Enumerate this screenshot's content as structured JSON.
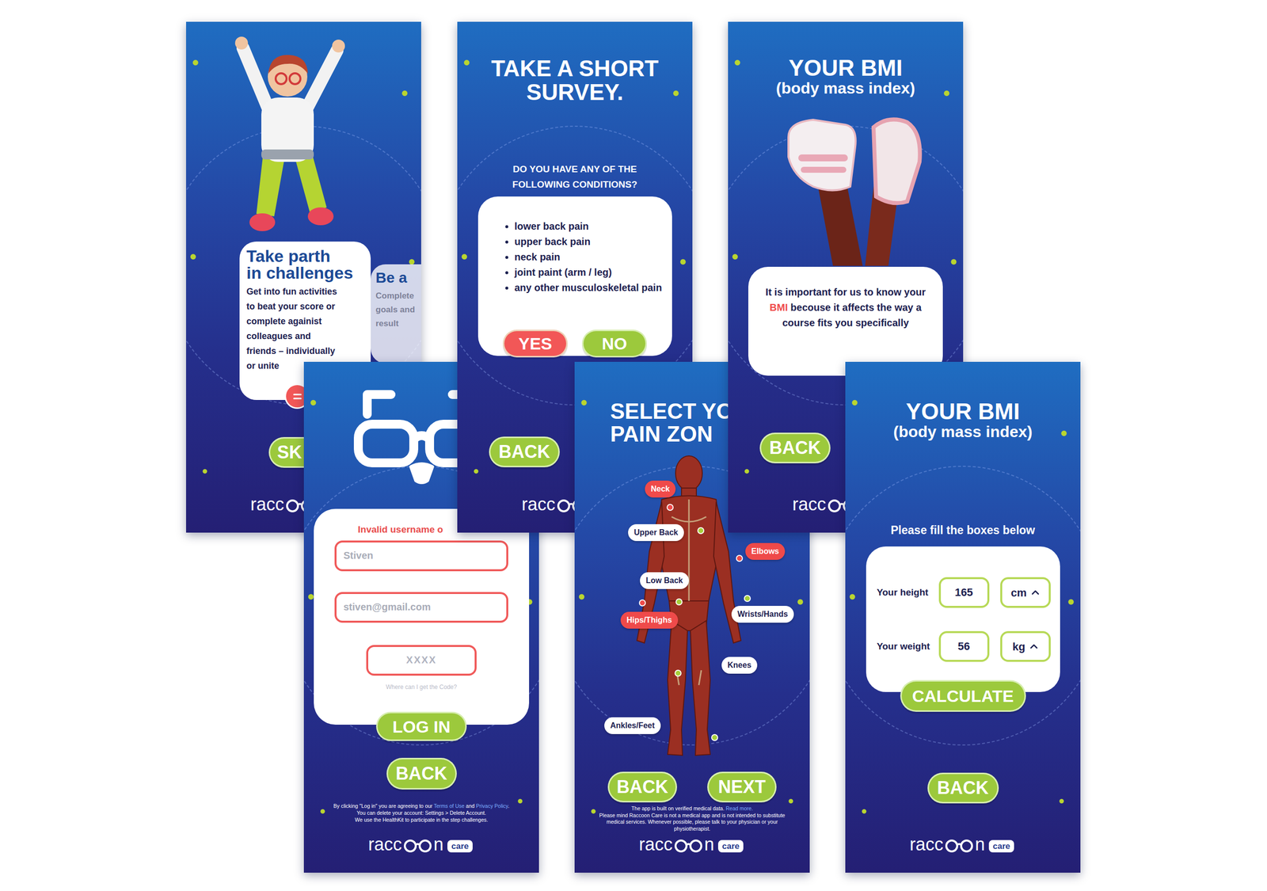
{
  "screens": {
    "challenges": {
      "card": {
        "title": [
          "Take parth",
          "in challenges"
        ],
        "body": [
          "Get into fun activities",
          "to beat your score or",
          "complete againist",
          "colleagues and",
          "friends – individually",
          "or unite"
        ]
      },
      "next_card": {
        "title": "Be a",
        "body": [
          "Complete",
          "goals and",
          "result"
        ]
      },
      "skip_button": "SK",
      "logo": {
        "text": "racc"
      }
    },
    "survey": {
      "title": [
        "TAKE A SHORT",
        "SURVEY."
      ],
      "question": [
        "DO YOU HAVE ANY OF THE",
        "FOLLOWING CONDITIONS?"
      ],
      "conditions": [
        "lower back pain",
        "upper back pain",
        "neck pain",
        "joint paint (arm / leg)",
        "any other musculoskeletal pain"
      ],
      "yes_button": "YES",
      "no_button": "NO",
      "back_button": "BACK",
      "logo": {
        "text": "racc"
      }
    },
    "bmi_intro": {
      "title": "YOUR BMI",
      "subtitle": "(body mass index)",
      "message": {
        "before": "It is important for us to know your ",
        "highlight": "BMI",
        "after": " becouse it affects the way a course fits you specifically"
      },
      "back_button": "BACK",
      "logo": {
        "text": "racc"
      }
    },
    "login": {
      "error": "Invalid username o",
      "fields": [
        {
          "value": "Stiven"
        },
        {
          "value": "stiven@gmail.com"
        }
      ],
      "code": {
        "placeholder": "XXXX"
      },
      "code_help": "Where can I get the Code?",
      "login_button": "LOG IN",
      "back_button": "BACK",
      "legal": [
        [
          {
            "kind": "text",
            "text": "By clicking \"Log in\" you are agreeing to our "
          },
          {
            "kind": "link",
            "text": "Terms of Use"
          },
          {
            "kind": "text",
            "text": " and "
          },
          {
            "kind": "link",
            "text": "Privacy Policy"
          },
          {
            "kind": "text",
            "text": "."
          }
        ],
        [
          {
            "kind": "text",
            "text": "You can delete  your account: Settings > Delete Account."
          }
        ],
        [
          {
            "kind": "text",
            "text": "We use the HealthKit to participate in the step challenges."
          }
        ]
      ],
      "logo": {
        "text": "racc",
        "tail": "n",
        "badge": "care"
      }
    },
    "pain_zone": {
      "title": [
        "SELECT YO",
        "PAIN ZON"
      ],
      "zones": [
        {
          "label": "Neck",
          "selected": true
        },
        {
          "label": "Upper Back",
          "selected": false
        },
        {
          "label": "Elbows",
          "selected": true
        },
        {
          "label": "Low Back",
          "selected": false
        },
        {
          "label": "Hips/Thighs",
          "selected": true
        },
        {
          "label": "Wrists/Hands",
          "selected": false
        },
        {
          "label": "Knees",
          "selected": false
        },
        {
          "label": "Ankles/Feet",
          "selected": false
        }
      ],
      "back_button": "BACK",
      "next_button": "NEXT",
      "disclaimer": [
        [
          {
            "kind": "text",
            "text": "The app is built on verified medical data. "
          },
          {
            "kind": "link",
            "text": "Read more."
          }
        ],
        [
          {
            "kind": "text",
            "text": "Please mind Raccoon Care is not a medical app and is not intended to substitute"
          }
        ],
        [
          {
            "kind": "text",
            "text": "medical services. Whenever possible, please talk to your physician or your"
          }
        ],
        [
          {
            "kind": "text",
            "text": "physiotherapist."
          }
        ]
      ],
      "logo": {
        "text": "racc",
        "tail": "n",
        "badge": "care"
      }
    },
    "bmi_form": {
      "title": "YOUR BMI",
      "subtitle": "(body mass index)",
      "instruction": "Please fill the boxes below",
      "fields": [
        {
          "label": "Your height",
          "value": "165",
          "unit": "cm"
        },
        {
          "label": "Your weight",
          "value": "56",
          "unit": "kg"
        }
      ],
      "calculate_button": "CALCULATE",
      "back_button": "BACK",
      "logo": {
        "text": "racc",
        "tail": "n",
        "badge": "care"
      }
    }
  }
}
